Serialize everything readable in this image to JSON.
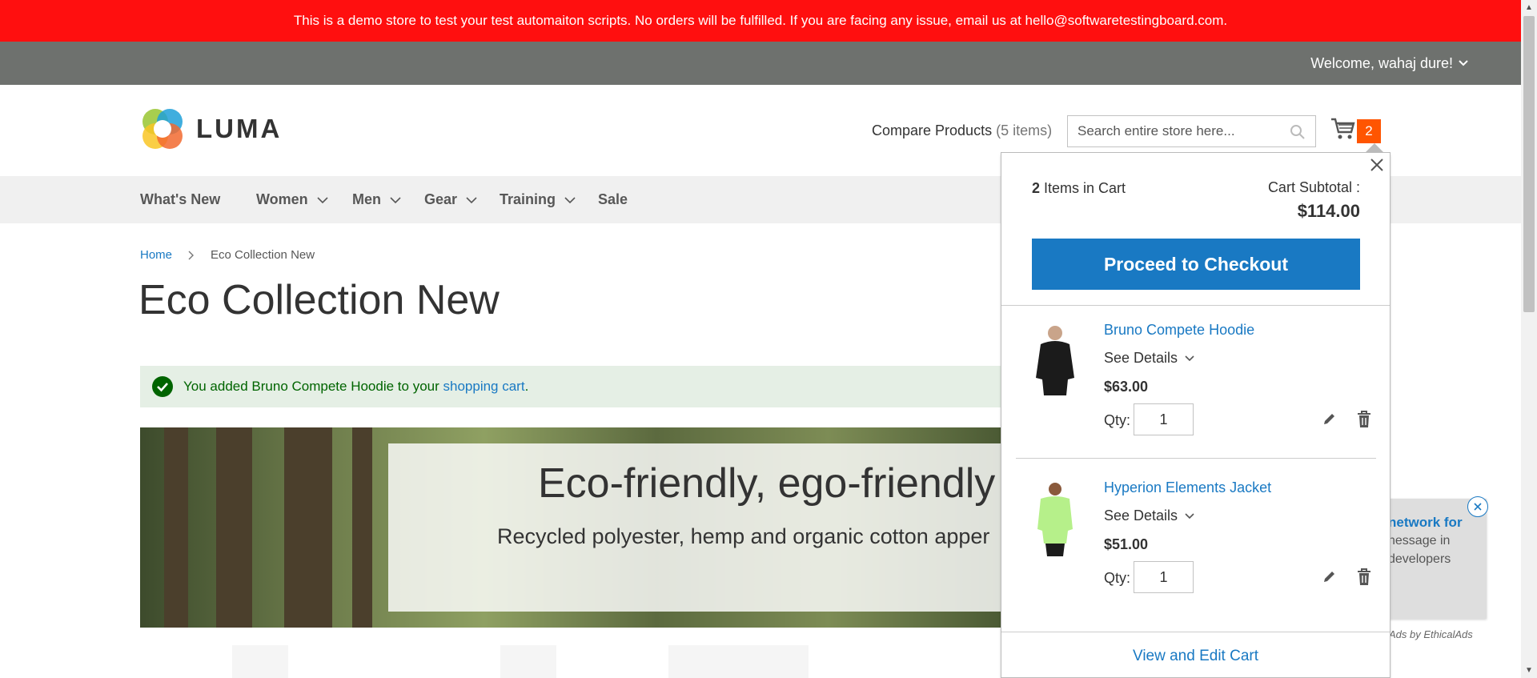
{
  "demo_notice": "This is a demo store to test your test automaiton scripts. No orders will be fulfilled. If you are facing any issue, email us at hello@softwaretestingboard.com.",
  "header": {
    "welcome": "Welcome, wahaj dure!",
    "logo_text": "LUMA",
    "compare_label": "Compare Products",
    "compare_count": "(5 items)",
    "search_placeholder": "Search entire store here...",
    "cart_count": "2"
  },
  "nav": {
    "items": [
      {
        "label": "What's New",
        "dropdown": false
      },
      {
        "label": "Women",
        "dropdown": true
      },
      {
        "label": "Men",
        "dropdown": true
      },
      {
        "label": "Gear",
        "dropdown": true
      },
      {
        "label": "Training",
        "dropdown": true
      },
      {
        "label": "Sale",
        "dropdown": false
      }
    ]
  },
  "breadcrumb": {
    "home": "Home",
    "current": "Eco Collection New"
  },
  "page_title": "Eco Collection New",
  "message": {
    "prefix": "You added Bruno Compete Hoodie to your",
    "link": "shopping cart",
    "suffix": "."
  },
  "banner": {
    "title": "Eco-friendly, ego-friendly",
    "subtitle": "Recycled polyester, hemp and organic cotton apper"
  },
  "ad": {
    "headline": "network for",
    "line1": "nessage in",
    "line2": "developers",
    "credit": "Ads by EthicalAds"
  },
  "minicart": {
    "items_count": "2",
    "items_label": "Items in Cart",
    "subtotal_label": "Cart Subtotal :",
    "subtotal_value": "$114.00",
    "checkout_label": "Proceed to Checkout",
    "see_details_label": "See Details",
    "qty_label": "Qty:",
    "items": [
      {
        "name": "Bruno Compete Hoodie",
        "price": "$63.00",
        "qty": "1"
      },
      {
        "name": "Hyperion Elements Jacket",
        "price": "$51.00",
        "qty": "1"
      }
    ],
    "view_cart_label": "View and Edit Cart"
  },
  "colors": {
    "demo_bar": "#ff0f0f",
    "top_bar": "#6e716e",
    "link": "#1979c3",
    "cart_badge": "#ff5501",
    "success_bg": "#e5efe5",
    "success_text": "#006400"
  }
}
